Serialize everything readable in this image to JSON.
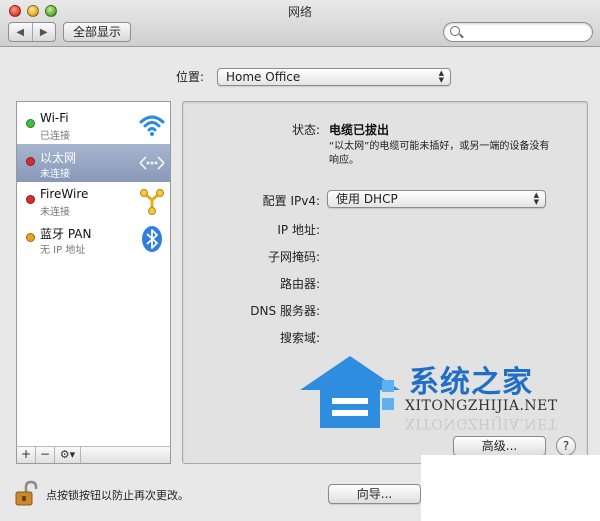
{
  "window": {
    "title": "网络"
  },
  "toolbar": {
    "back_glyph": "◀",
    "forward_glyph": "▶",
    "show_all_label": "全部显示",
    "search_placeholder": ""
  },
  "location": {
    "label": "位置:",
    "value": "Home Office"
  },
  "services": [
    {
      "name": "Wi-Fi",
      "status": "已连接",
      "dot_color": "#3fbf3f",
      "icon": "wifi-icon"
    },
    {
      "name": "以太网",
      "status": "未连接",
      "dot_color": "#d62c2c",
      "icon": "ethernet-icon",
      "selected": true
    },
    {
      "name": "FireWire",
      "status": "未连接",
      "dot_color": "#d62c2c",
      "icon": "firewire-icon"
    },
    {
      "name": "蓝牙 PAN",
      "status": "无 IP 地址",
      "dot_color": "#f0a020",
      "icon": "bluetooth-icon"
    }
  ],
  "sidebar_toolbar": {
    "add": "+",
    "remove": "−",
    "gear": "⚙▾"
  },
  "detail": {
    "status_label": "状态:",
    "status_value": "电缆已拔出",
    "status_description": "“以太网”的电缆可能未插好，或另一端的设备没有响应。",
    "configure_label": "配置 IPv4:",
    "configure_value": "使用 DHCP",
    "ip_label": "IP 地址:",
    "subnet_label": "子网掩码:",
    "router_label": "路由器:",
    "dns_label": "DNS 服务器:",
    "search_domain_label": "搜索域:",
    "advanced_label": "高级...",
    "help_label": "?"
  },
  "footer": {
    "lock_text": "点按锁按钮以防止再次更改。",
    "assistant_label": "向导..."
  },
  "watermark": {
    "cn": "系统之家",
    "en": "XITONGZHIJIA.NET"
  },
  "colors": {
    "selection": "#8898b8",
    "accent_blue": "#1f6fc7"
  }
}
